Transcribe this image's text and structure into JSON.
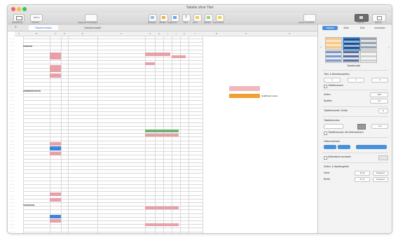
{
  "window": {
    "title": "Tabelle ohne Titel"
  },
  "colors": {
    "accent": "#4a90d9",
    "pink": "#e8a0a8",
    "orange": "#f0a030",
    "blue": "#3b86d8",
    "green": "#6fb36f"
  },
  "toolbar": {
    "left": [
      {
        "label": "Darstellung",
        "icon": "sidebar-icon"
      },
      {
        "label": "Zoomen",
        "value": "100 %"
      }
    ],
    "center_left": [
      {
        "label": "Kategorie hinzufügen"
      }
    ],
    "center": [
      {
        "label": "Einfügen",
        "icon": "insert-icon"
      },
      {
        "label": "Tabelle",
        "icon": "table-icon"
      },
      {
        "label": "Diagramm",
        "icon": "chart-icon"
      },
      {
        "label": "Text",
        "icon": "text-icon"
      },
      {
        "label": "Form",
        "icon": "shape-icon"
      },
      {
        "label": "Medien",
        "icon": "media-icon"
      },
      {
        "label": "Kommentar",
        "icon": "comment-icon"
      }
    ],
    "center_right": [
      {
        "label": "Zusammenarbeit"
      }
    ],
    "right": [
      {
        "label": "Format",
        "icon": "format-icon"
      },
      {
        "label": "Ordnen",
        "icon": "arrange-icon"
      }
    ]
  },
  "sheets": [
    "Tabellenblatt1",
    "Tabellenblatt2"
  ],
  "columns": [
    "A",
    "B",
    "C",
    "D",
    "E",
    "F",
    "G",
    "H",
    "I",
    "J",
    "K",
    "L",
    "M",
    "N",
    "O"
  ],
  "sections": [
    "WINDOW",
    "ADMINISTRATOR",
    "TRANSFER"
  ],
  "side_notes": [
    "Qualification levels"
  ],
  "inspector": {
    "tabs": [
      "Tabelle",
      "Zelle",
      "Text",
      "Anordnen"
    ],
    "style_caption": "Tabellenstile",
    "fields": {
      "header_footer_title": "Titel- & Abschlusszeilen",
      "header_rows": "1",
      "header_columns": "1",
      "footer_rows": "0",
      "title_check": "Tabellenname",
      "rows_label": "Zeilen",
      "rows_value": "108",
      "cols_label": "Spalten",
      "cols_value": "14",
      "font_size_label": "Tabellenschrift: Größe",
      "font_size_value": "A",
      "outline_label": "Tabellenkontur",
      "outline_value": "1 pt",
      "outline_check": "Tabellenkontur mit Zeilenrahmen",
      "gridlines_label": "Gitternetzlinien",
      "alt_rows_label": "Zeilenfarbe wechseln",
      "row_col_size_label": "Zeilen- & Spaltengröße",
      "height_label": "Höhe",
      "height_value": "15 pt",
      "height_btn": "Passend",
      "width_label": "Breite",
      "width_value": "67 pt",
      "width_btn": "Passend"
    }
  }
}
